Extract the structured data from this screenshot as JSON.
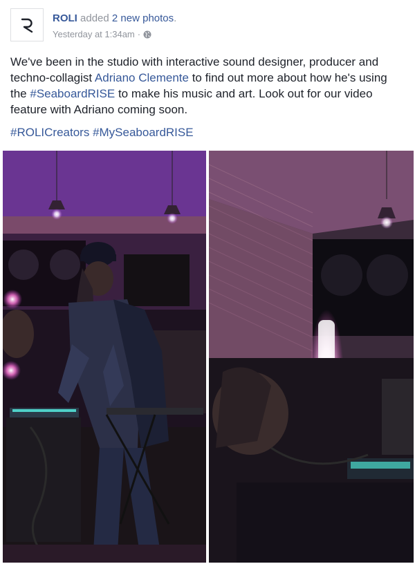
{
  "post": {
    "author": "ROLI",
    "action_prefix": "added",
    "action_link": "2 new photos",
    "action_suffix": ".",
    "timestamp": "Yesterday at 1:34am",
    "separator": "·",
    "privacy_icon": "globe-icon",
    "avatar_icon": "roli-logo-icon",
    "text_part1": "We've been in the studio with interactive sound designer, producer and techno-collagist ",
    "mention": "Adriano Clemente",
    "text_part2": " to find out more about how he's using the ",
    "hashtag_inline": "#SeaboardRISE",
    "text_part3": " to make his music and art. Look out for our video feature with Adriano coming soon.",
    "hashtags": [
      "#ROLICreators",
      "#MySeaboardRISE"
    ]
  },
  "photos": [
    {
      "name": "photo-1"
    },
    {
      "name": "photo-2"
    }
  ],
  "colors": {
    "link": "#365899",
    "meta": "#90949c",
    "text": "#1d2129"
  }
}
